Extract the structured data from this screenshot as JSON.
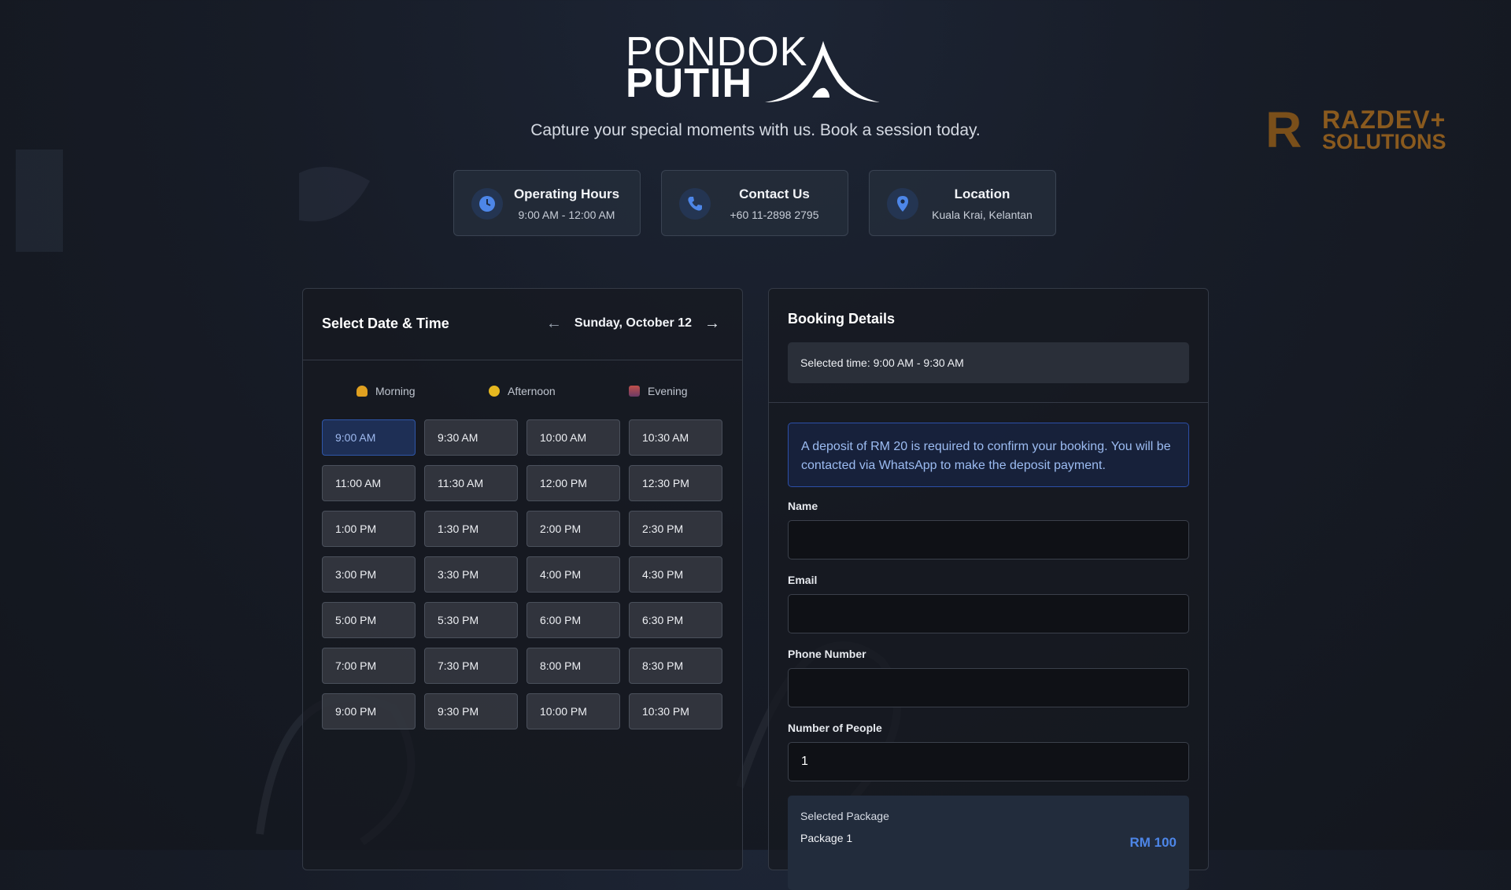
{
  "header": {
    "logo_line1": "PONDOK",
    "logo_line2": "PUTIH",
    "tagline": "Capture your special moments with us. Book a session today.",
    "partner_logo_mark": "R",
    "partner_logo_line1": "RAZDEV+",
    "partner_logo_line2": "SOLUTIONS"
  },
  "info_cards": [
    {
      "title": "Operating Hours",
      "value": "9:00 AM - 12:00 AM",
      "icon": "clock-icon"
    },
    {
      "title": "Contact Us",
      "value": "+60 11-2898 2795",
      "icon": "phone-icon"
    },
    {
      "title": "Location",
      "value": "Kuala Krai, Kelantan",
      "icon": "map-pin-icon"
    }
  ],
  "schedule": {
    "title": "Select Date & Time",
    "prev_arrow": "←",
    "next_arrow": "→",
    "date": "Sunday, October 12",
    "periods": [
      {
        "label": "Morning",
        "color": "#e0a020"
      },
      {
        "label": "Afternoon",
        "color": "#e6b820"
      },
      {
        "label": "Evening",
        "color": "#c0504a"
      }
    ],
    "selected_slot": "9:00 AM",
    "slots": [
      "9:00 AM",
      "9:30 AM",
      "10:00 AM",
      "10:30 AM",
      "11:00 AM",
      "11:30 AM",
      "12:00 PM",
      "12:30 PM",
      "1:00 PM",
      "1:30 PM",
      "2:00 PM",
      "2:30 PM",
      "3:00 PM",
      "3:30 PM",
      "4:00 PM",
      "4:30 PM",
      "5:00 PM",
      "5:30 PM",
      "6:00 PM",
      "6:30 PM",
      "7:00 PM",
      "7:30 PM",
      "8:00 PM",
      "8:30 PM",
      "9:00 PM",
      "9:30 PM",
      "10:00 PM",
      "10:30 PM"
    ]
  },
  "booking": {
    "title": "Booking Details",
    "selected_time": "Selected time: 9:00 AM - 9:30 AM",
    "notice": "A deposit of RM 20 is required to confirm your booking. You will be contacted via WhatsApp to make the deposit payment.",
    "fields": {
      "name_label": "Name",
      "name_value": "",
      "email_label": "Email",
      "email_value": "",
      "phone_label": "Phone Number",
      "phone_value": "",
      "people_label": "Number of People",
      "people_value": "1"
    },
    "package": {
      "label": "Selected Package",
      "name": "Package 1",
      "price": "RM 100"
    }
  },
  "colors": {
    "accent": "#4d86e8",
    "selected_slot_bg": "#1e2f55",
    "partner_brand": "#8a5a1e"
  }
}
